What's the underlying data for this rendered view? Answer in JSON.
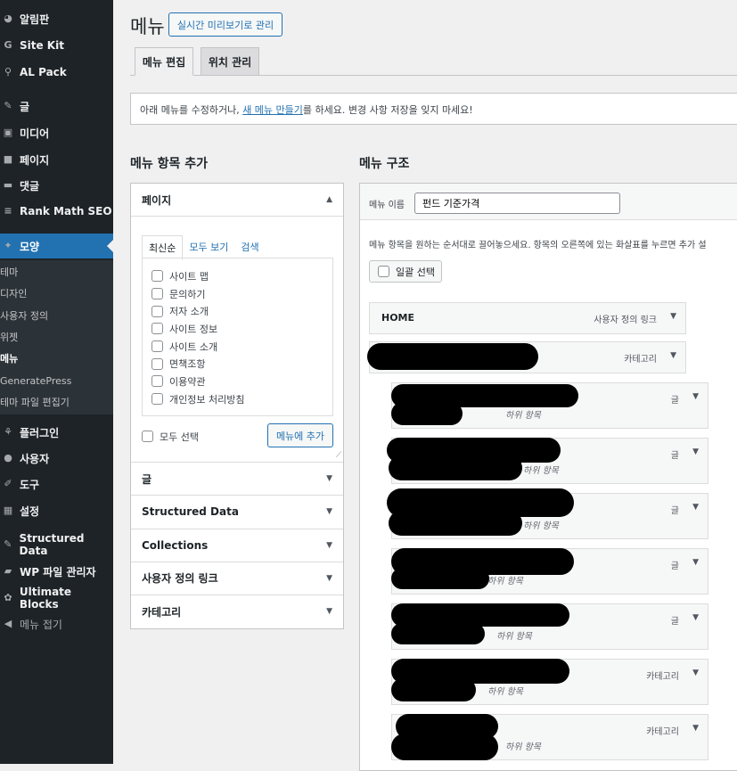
{
  "sidebar": {
    "items": [
      {
        "label": "알림판",
        "icon": "dashboard-icon"
      },
      {
        "label": "Site Kit",
        "icon": "google-icon"
      },
      {
        "label": "AL Pack",
        "icon": "pack-icon"
      },
      {
        "label": "글",
        "icon": "pin-icon"
      },
      {
        "label": "미디어",
        "icon": "media-icon"
      },
      {
        "label": "페이지",
        "icon": "page-icon"
      },
      {
        "label": "댓글",
        "icon": "comment-icon"
      },
      {
        "label": "Rank Math SEO",
        "icon": "chart-icon"
      },
      {
        "label": "모양",
        "icon": "brush-icon"
      },
      {
        "label": "플러그인",
        "icon": "plugin-icon"
      },
      {
        "label": "사용자",
        "icon": "user-icon"
      },
      {
        "label": "도구",
        "icon": "wrench-icon"
      },
      {
        "label": "설정",
        "icon": "settings-icon"
      },
      {
        "label": "Structured Data",
        "icon": "pin-icon"
      },
      {
        "label": "WP 파일 관리자",
        "icon": "folder-icon"
      },
      {
        "label": "Ultimate Blocks",
        "icon": "blocks-icon"
      },
      {
        "label": "메뉴 접기",
        "icon": "collapse-icon"
      }
    ],
    "submenu": [
      "테마",
      "디자인",
      "사용자 정의",
      "위젯",
      "메뉴",
      "GeneratePress",
      "테마 파일 편집기"
    ]
  },
  "header": {
    "title": "메뉴",
    "preview_button": "실시간 미리보기로 관리",
    "tabs": [
      "메뉴 편집",
      "위치 관리"
    ]
  },
  "notice": {
    "before": "아래 메뉴를 수정하거나, ",
    "link": "새 메뉴 만들기",
    "after": "를 하세요. 변경 사항 저장을 잊지 마세요!"
  },
  "add_items": {
    "heading": "메뉴 항목 추가",
    "pages_title": "페이지",
    "tabs": [
      "최신순",
      "모두 보기",
      "검색"
    ],
    "pages": [
      "사이트 맵",
      "문의하기",
      "저자 소개",
      "사이트 정보",
      "사이트 소개",
      "면책조항",
      "이용약관",
      "개인정보 처리방침"
    ],
    "select_all": "모두 선택",
    "add_button": "메뉴에 추가",
    "sections": [
      "글",
      "Structured Data",
      "Collections",
      "사용자 정의 링크",
      "카테고리"
    ]
  },
  "structure": {
    "heading": "메뉴 구조",
    "name_label": "메뉴 이름",
    "name_value": "펀드 기준가격",
    "instructions": "메뉴 항목을 원하는 순서대로 끌어놓으세요. 항목의 오른쪽에 있는 화살표를 누르면 추가 설",
    "bulk_select": "일괄 선택",
    "items": [
      {
        "label": "HOME",
        "type": "사용자 정의 링크"
      },
      {
        "label": "",
        "type": "카테고리"
      },
      {
        "label": "",
        "type": "글",
        "sub": "하위 항목"
      },
      {
        "label": "",
        "type": "글",
        "sub": "하위 항목"
      },
      {
        "label": "",
        "type": "글",
        "sub": "하위 항목"
      },
      {
        "label": "",
        "type": "글",
        "sub": "하위 항목"
      },
      {
        "label": "",
        "type": "글",
        "sub": "하위 항목"
      },
      {
        "label": "",
        "type": "카테고리",
        "sub": "하위 항목"
      },
      {
        "label": "",
        "type": "카테고리",
        "sub": "하위 항목"
      }
    ]
  }
}
